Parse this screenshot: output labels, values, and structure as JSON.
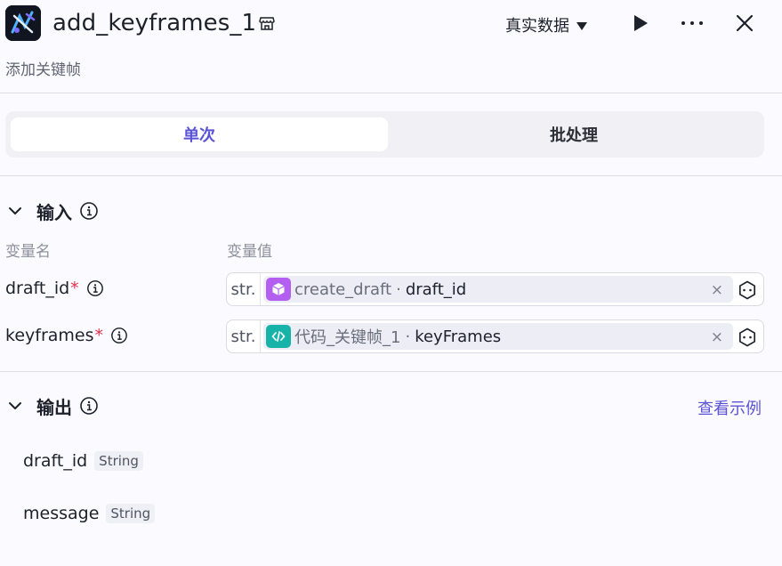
{
  "header": {
    "logo_icon": "app-logo",
    "title": "add_keyframes_1",
    "data_mode": "真实数据",
    "actions": [
      "play-icon",
      "more-icon",
      "close-icon"
    ]
  },
  "node": {
    "description": "添加关键帧"
  },
  "tabs": [
    {
      "label": "单次",
      "active": true
    },
    {
      "label": "批处理",
      "active": false
    }
  ],
  "input_section": {
    "title": "输入",
    "col_name": "变量名",
    "col_value": "变量值",
    "params": [
      {
        "name": "draft_id",
        "required_mark": "*",
        "type": "str.",
        "ref_node": "create_draft",
        "sep": "·",
        "ref_var": "draft_id",
        "node_icon": "cube-icon",
        "node_color": "#b35ff0"
      },
      {
        "name": "keyframes",
        "required_mark": "*",
        "type": "str.",
        "ref_node": "代码_关键帧_1",
        "sep": "·",
        "ref_var": "keyFrames",
        "node_icon": "code-icon",
        "node_color": "#18b3a8"
      }
    ],
    "clear_glyph": "×"
  },
  "output_section": {
    "title": "输出",
    "example_link": "查看示例",
    "fields": [
      {
        "name": "draft_id",
        "type": "String"
      },
      {
        "name": "message",
        "type": "String"
      }
    ]
  },
  "colors": {
    "accent": "#5b54d6",
    "required": "#e0304b",
    "background": "#fbfaff"
  }
}
